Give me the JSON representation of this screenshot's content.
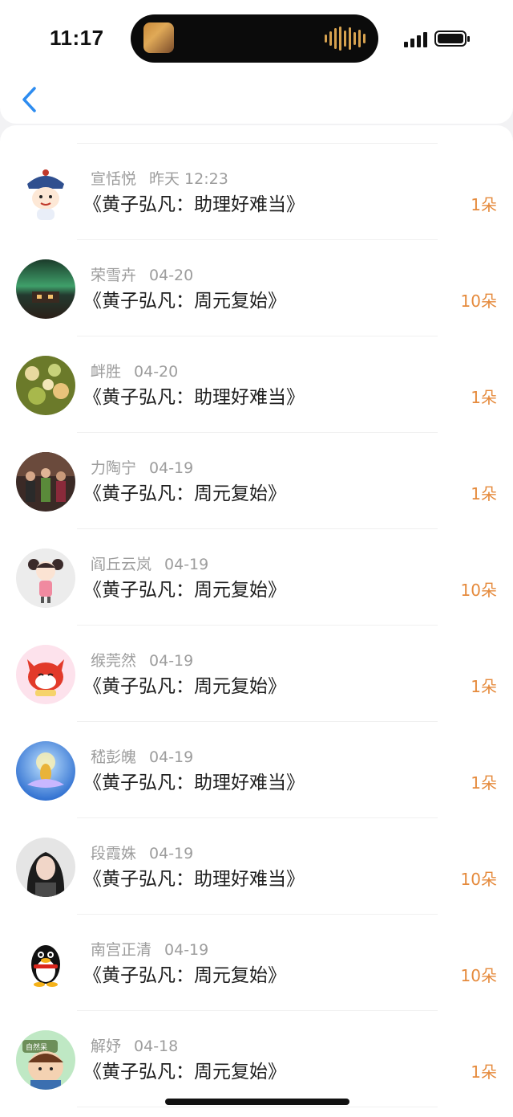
{
  "status_bar": {
    "time": "11:17"
  },
  "nav": {
    "back_icon": "chevron-left-icon"
  },
  "colors": {
    "accent_blue": "#2d8cf0",
    "count_orange": "#e58a3c",
    "name_gray": "#9d9d9d"
  },
  "rows": [
    {
      "name": "宣恬悦",
      "date": "昨天 12:23",
      "title": "《黄子弘凡：助理好难当》",
      "count": "1朵",
      "avatar": "cartoon-qing-official-avatar"
    },
    {
      "name": "荣雪卉",
      "date": "04-20",
      "title": "《黄子弘凡：周元复始》",
      "count": "10朵",
      "avatar": "aurora-landscape-avatar"
    },
    {
      "name": "衅胜",
      "date": "04-20",
      "title": "《黄子弘凡：助理好难当》",
      "count": "1朵",
      "avatar": "food-platter-avatar"
    },
    {
      "name": "力陶宁",
      "date": "04-19",
      "title": "《黄子弘凡：周元复始》",
      "count": "1朵",
      "avatar": "group-photo-avatar"
    },
    {
      "name": "阎丘云岚",
      "date": "04-19",
      "title": "《黄子弘凡：周元复始》",
      "count": "10朵",
      "avatar": "cartoon-girl-avatar"
    },
    {
      "name": "缑莞然",
      "date": "04-19",
      "title": "《黄子弘凡：周元复始》",
      "count": "1朵",
      "avatar": "red-fox-cartoon-avatar"
    },
    {
      "name": "嵇彭魄",
      "date": "04-19",
      "title": "《黄子弘凡：助理好难当》",
      "count": "1朵",
      "avatar": "buddha-lotus-avatar"
    },
    {
      "name": "段霞姝",
      "date": "04-19",
      "title": "《黄子弘凡：助理好难当》",
      "count": "10朵",
      "avatar": "woman-portrait-avatar"
    },
    {
      "name": "南宫正清",
      "date": "04-19",
      "title": "《黄子弘凡：周元复始》",
      "count": "10朵",
      "avatar": "penguin-avatar"
    },
    {
      "name": "解妤",
      "date": "04-18",
      "title": "《黄子弘凡：周元复始》",
      "count": "1朵",
      "avatar": "cartoon-boy-avatar",
      "avatar_text": "自然呆"
    }
  ]
}
